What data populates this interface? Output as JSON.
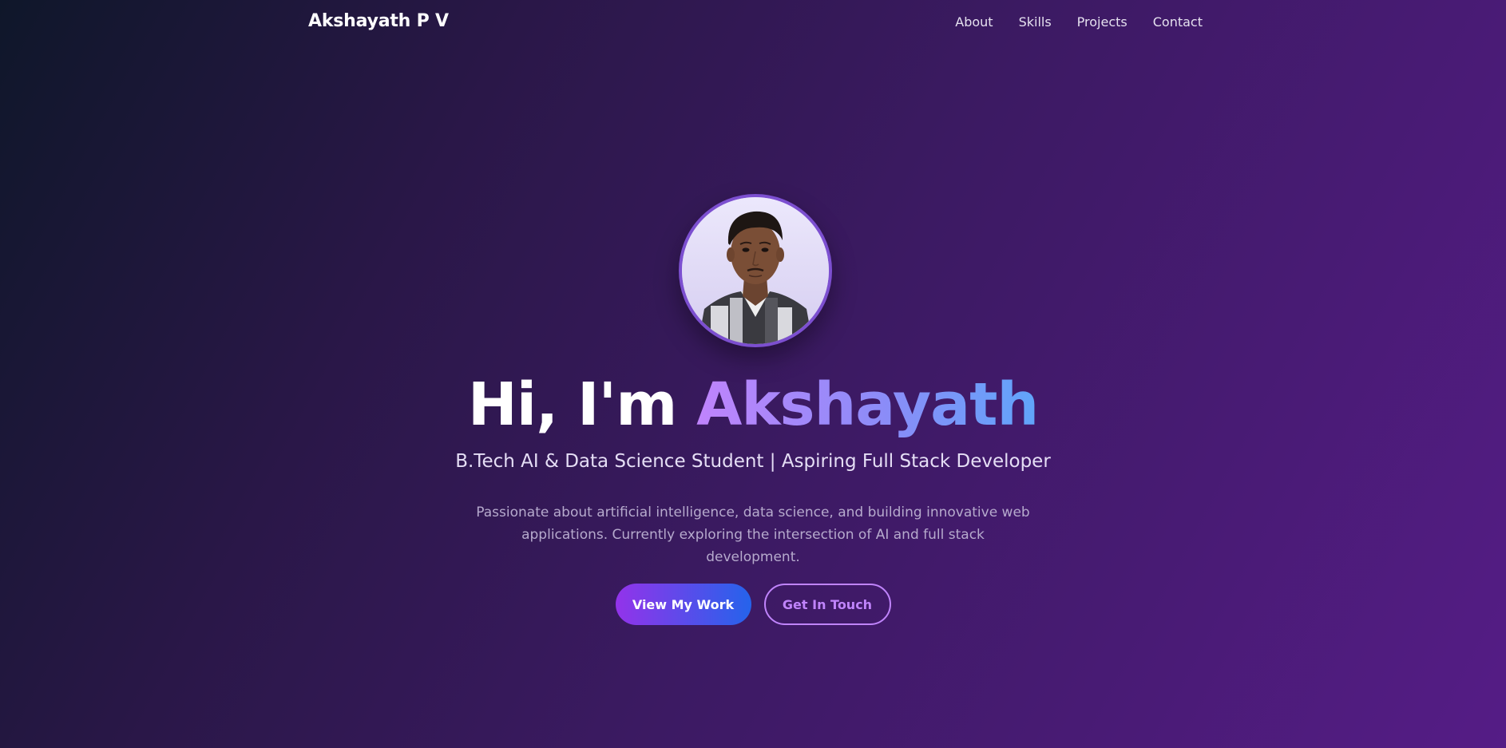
{
  "nav": {
    "brand": "Akshayath P V",
    "links": [
      "About",
      "Skills",
      "Projects",
      "Contact"
    ]
  },
  "hero": {
    "greeting": "Hi, I'm ",
    "name": "Akshayath",
    "subtitle": "B.Tech AI & Data Science Student | Aspiring Full Stack Developer",
    "description": "Passionate about artificial intelligence, data science, and building innovative web applications. Currently exploring the intersection of AI and full stack development.",
    "primary_button": "View My Work",
    "secondary_button": "Get In Touch",
    "avatar_icon": "profile-photo"
  },
  "colors": {
    "accent_purple": "#c084fc",
    "accent_blue": "#60a5fa",
    "button_gradient_start": "#9333ea",
    "button_gradient_end": "#2563eb",
    "background_dark": "#0f172a",
    "background_purple": "#551c86"
  }
}
